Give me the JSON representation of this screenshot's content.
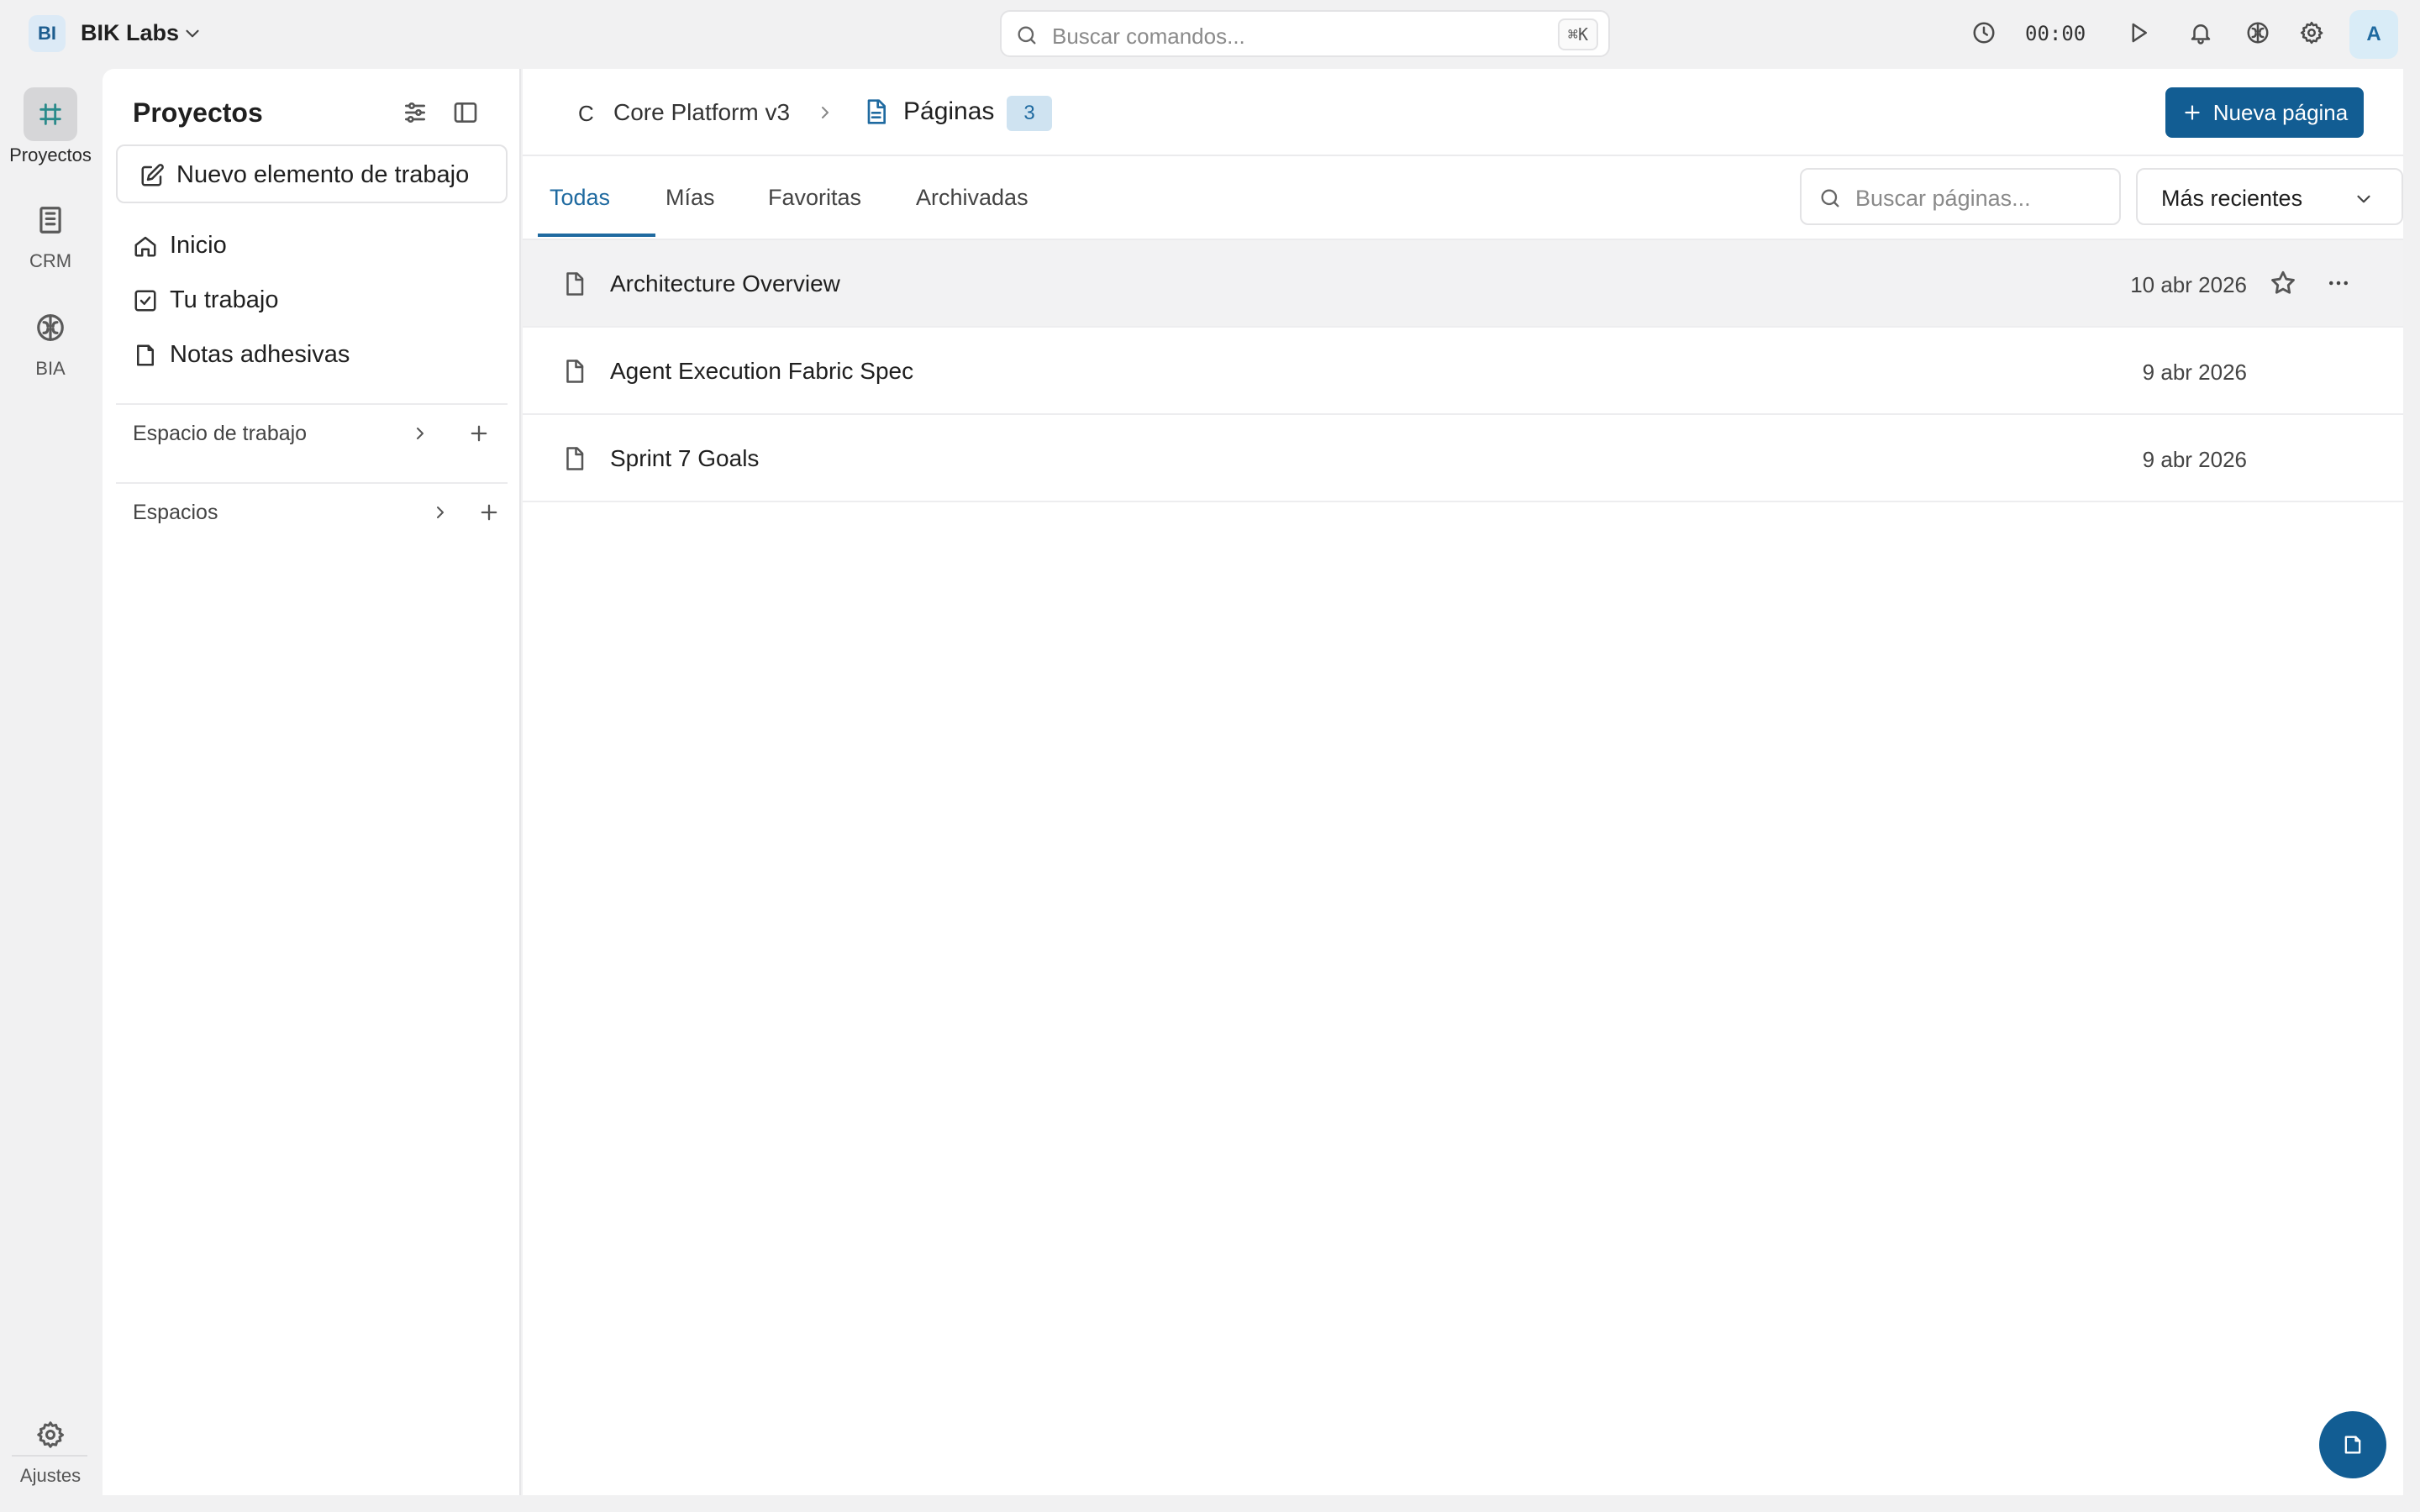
{
  "workspace": {
    "initials": "BI",
    "name": "BIK Labs"
  },
  "command_search": {
    "placeholder": "Buscar comandos...",
    "shortcut": "⌘K"
  },
  "topbar": {
    "timer": "00:00",
    "avatar_initial": "A"
  },
  "rail": {
    "items": [
      {
        "label": "Proyectos",
        "icon": "projects-icon",
        "active": true
      },
      {
        "label": "CRM",
        "icon": "building-icon",
        "active": false
      },
      {
        "label": "BIA",
        "icon": "brain-icon",
        "active": false
      }
    ],
    "settings_label": "Ajustes"
  },
  "sidebar": {
    "title": "Proyectos",
    "new_work_item": "Nuevo elemento de trabajo",
    "nav": [
      {
        "label": "Inicio",
        "icon": "home-icon"
      },
      {
        "label": "Tu trabajo",
        "icon": "checkbox-icon"
      },
      {
        "label": "Notas adhesivas",
        "icon": "note-icon"
      }
    ],
    "sections": [
      {
        "label": "Espacio de trabajo"
      },
      {
        "label": "Espacios"
      }
    ]
  },
  "header": {
    "project_initial": "C",
    "project_name": "Core Platform v3",
    "page_title": "Páginas",
    "page_count": "3",
    "new_page_label": "Nueva página"
  },
  "tabs": [
    {
      "label": "Todas",
      "active": true
    },
    {
      "label": "Mías",
      "active": false
    },
    {
      "label": "Favoritas",
      "active": false
    },
    {
      "label": "Archivadas",
      "active": false
    }
  ],
  "page_search": {
    "placeholder": "Buscar páginas..."
  },
  "sort": {
    "selected": "Más recientes"
  },
  "pages": [
    {
      "title": "Architecture Overview",
      "date": "10 abr 2026",
      "hovered": true
    },
    {
      "title": "Agent Execution Fabric Spec",
      "date": "9 abr 2026",
      "hovered": false
    },
    {
      "title": "Sprint 7 Goals",
      "date": "9 abr 2026",
      "hovered": false
    }
  ],
  "colors": {
    "accent": "#125d93",
    "accent_text": "#1f6aa0",
    "badge_bg": "#cfe3f1"
  }
}
